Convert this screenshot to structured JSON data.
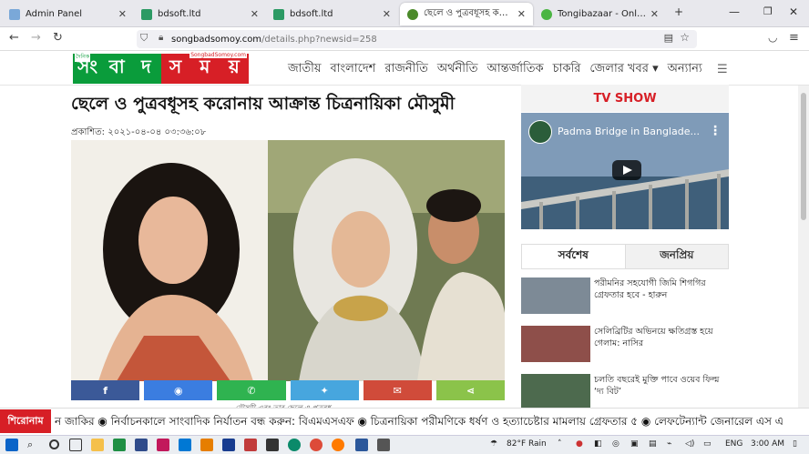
{
  "browser": {
    "tabs": [
      {
        "title": "Admin Panel",
        "active": false,
        "color": "#7aa8d8"
      },
      {
        "title": "bdsoft.ltd",
        "active": false,
        "color": "#2c9a64"
      },
      {
        "title": "bdsoft.ltd",
        "active": false,
        "color": "#2c9a64"
      },
      {
        "title": "ছেলে ও পুত্রবধূসহ করোনায় আক্রান্ত চিত্র",
        "active": true,
        "color": "#4b8a2a"
      },
      {
        "title": "Tongibazaar - Online Grocery S",
        "active": false,
        "color": "#4bb543"
      }
    ],
    "new_tab": "+",
    "url_domain": "songbadsomoy.com",
    "url_path": "/details.php?newsid=258"
  },
  "site": {
    "logo": {
      "prefix": "দৈনিক",
      "letters": [
        "সং",
        "বা",
        "দ",
        "স",
        "ম",
        "য়"
      ],
      "tag": "SongbadSomoy.com"
    },
    "menu": [
      "জাতীয়",
      "বাংলাদেশ",
      "রাজনীতি",
      "অর্থনীতি",
      "আন্তর্জাতিক",
      "চাকরি",
      "জেলার খবর ▾",
      "অন্যান্য"
    ],
    "colors": {
      "green": "#0a9c3b",
      "red": "#d71f26"
    }
  },
  "article": {
    "headline": "ছেলে ও পুত্রবধূসহ করোনায় আক্রান্ত চিত্রনায়িকা মৌসুমী",
    "date": "প্রকাশিত: ২০২১-০৪-০৪ ০৩:৩৬:০৮",
    "caption": "মৌসুমী এবং তার ছেলে ও পুত্রবধূ",
    "share": [
      {
        "icon": "f",
        "name": "facebook-share-button",
        "color": "#3b5998"
      },
      {
        "icon": "◉",
        "name": "messenger-share-button",
        "color": "#3b7de0"
      },
      {
        "icon": "✆",
        "name": "whatsapp-share-button",
        "color": "#2fb350"
      },
      {
        "icon": "✦",
        "name": "twitter-share-button",
        "color": "#47a6de"
      },
      {
        "icon": "✉",
        "name": "email-share-button",
        "color": "#d04b3a"
      },
      {
        "icon": "⋖",
        "name": "sharethis-share-button",
        "color": "#8bc34a"
      }
    ]
  },
  "sidebar": {
    "tv_title": "TV SHOW",
    "video_title": "Padma Bridge in Banglade...",
    "tab_latest": "সর্বশেষ",
    "tab_popular": "জনপ্রিয়",
    "news": [
      {
        "text": "পরীমনির সহযোগী জিমি শিগগির গ্রেফতার হবে - হারুন"
      },
      {
        "text": "সেলিব্রিটির অভিনয়ে ক্ষতিগ্রস্ত হয়ে গেলাম: নাসির"
      },
      {
        "text": "চলতি বছরেই মুক্তি পাবে ওয়েব ফিল্ম ‘দ্য বিট’"
      }
    ]
  },
  "ticker": {
    "label": "শিরোনাম",
    "text": "ন জাকির   ◉ নির্বাচনকালে সাংবাদিক নির্যাতন বন্ধ করুন: বিএমএসএফ   ◉ চিত্রনায়িকা পরীমণিকে ধর্ষণ ও হত্যাচেষ্টার মামলায় গ্রেফতার ৫   ◉ লেফটেন্যান্ট জেনারেল এস এ"
  },
  "taskbar": {
    "weather": "82°F  Rain",
    "lang": "ENG",
    "time": "3:00 AM"
  }
}
